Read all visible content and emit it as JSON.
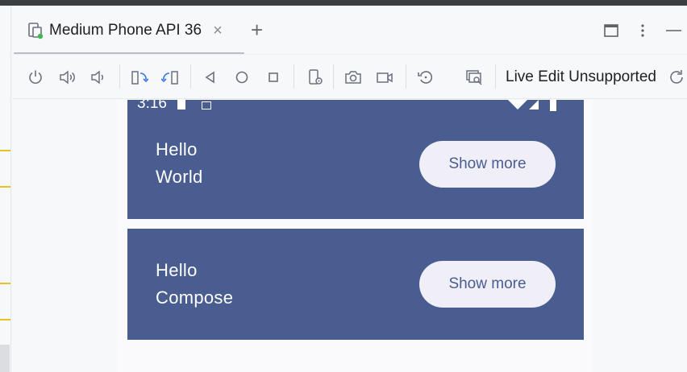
{
  "tab": {
    "title": "Medium Phone API 36",
    "close_symbol": "×",
    "add_symbol": "+"
  },
  "toolbar": {
    "live_edit_label": "Live Edit Unsupported"
  },
  "statusbar": {
    "time": "3:16"
  },
  "cards": [
    {
      "greeting": "Hello",
      "name": "World",
      "button_label": "Show more"
    },
    {
      "greeting": "Hello",
      "name": "Compose",
      "button_label": "Show more"
    }
  ],
  "colors": {
    "card_background": "#4a5d90",
    "button_background": "#f0eff7",
    "gutter_marker": "#e6c229",
    "device_active_dot": "#3fb950"
  },
  "icons": [
    "device-icon",
    "close-icon",
    "add-tab-icon",
    "window-restore-icon",
    "more-options-icon",
    "minimize-icon",
    "power-icon",
    "volume-up-icon",
    "volume-down-icon",
    "rotate-left-icon",
    "rotate-right-icon",
    "back-icon",
    "home-icon",
    "overview-icon",
    "device-settings-icon",
    "screenshot-icon",
    "screen-record-icon",
    "reset-icon",
    "snapshot-icon",
    "refresh-icon"
  ]
}
